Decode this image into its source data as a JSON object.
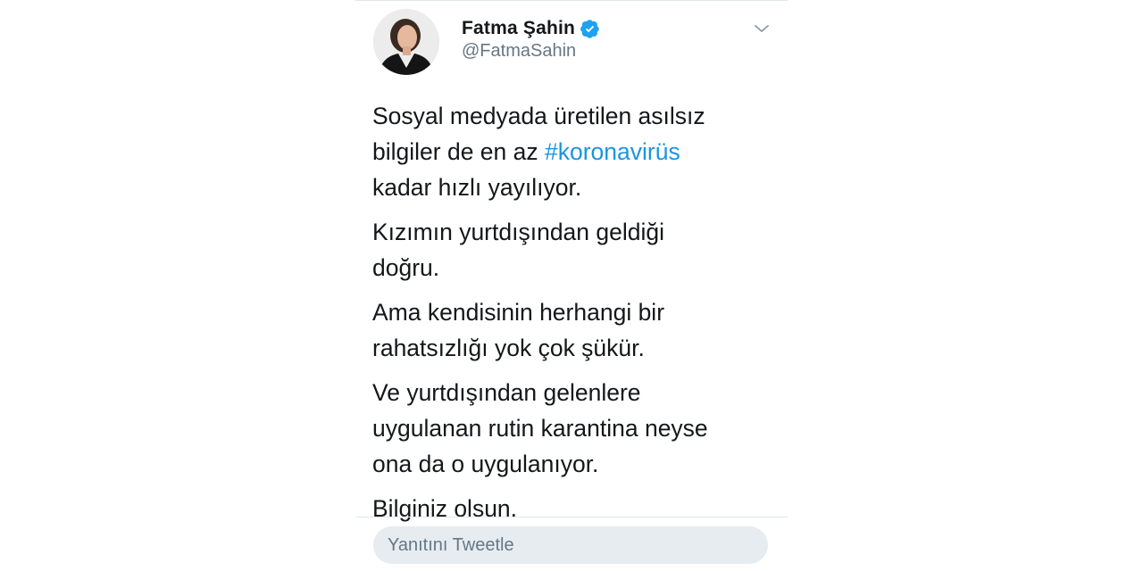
{
  "tweet": {
    "author": {
      "display_name": "Fatma Şahin",
      "handle": "@FatmaSahin",
      "verified": true,
      "avatar_icon": "profile-photo"
    },
    "menu_icon": "chevron-down-icon",
    "paragraphs": [
      {
        "line1": "Sosyal medyada üretilen asılsız",
        "line2_before": "bilgiler de en az ",
        "line2_hashtag": "#koronavirüs",
        "line3": "kadar hızlı yayılıyor."
      },
      {
        "lines": [
          "Kızımın yurtdışından geldiği",
          "doğru."
        ]
      },
      {
        "lines": [
          "Ama kendisinin herhangi bir",
          "rahatsızlığı yok çok şükür."
        ]
      },
      {
        "lines": [
          "Ve yurtdışından gelenlere",
          "uygulanan rutin karantina neyse",
          "ona da o uygulanıyor."
        ]
      },
      {
        "lines": [
          "Bilginiz olsun."
        ]
      }
    ]
  },
  "reply": {
    "placeholder": "Yanıtını Tweetle"
  },
  "colors": {
    "text": "#14171a",
    "secondary": "#657786",
    "link": "#1b95e0",
    "verified_badge": "#1da1f2",
    "reply_bg": "#e6ecf0"
  }
}
